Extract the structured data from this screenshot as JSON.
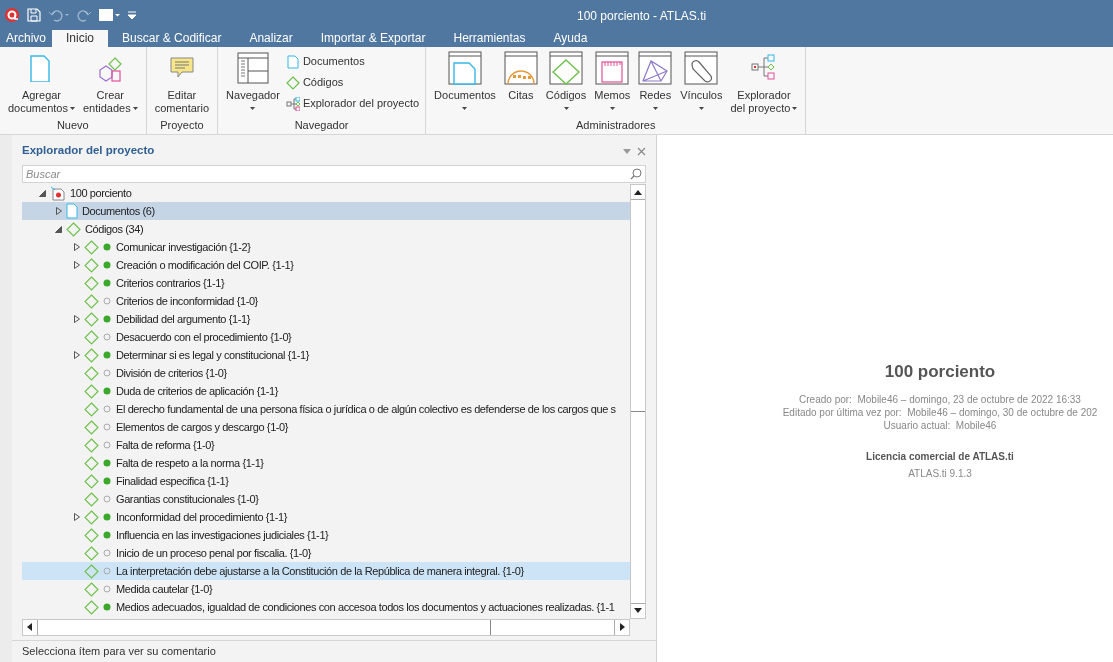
{
  "window": {
    "title": "100 porciento - ATLAS.ti"
  },
  "menu_tabs": [
    {
      "label": "Archivo",
      "selected": false
    },
    {
      "label": "Inicio",
      "selected": true
    },
    {
      "label": "Buscar & Codificar",
      "selected": false
    },
    {
      "label": "Analizar",
      "selected": false
    },
    {
      "label": "Importar & Exportar",
      "selected": false
    },
    {
      "label": "Herramientas",
      "selected": false
    },
    {
      "label": "Ayuda",
      "selected": false
    }
  ],
  "ribbon": [
    {
      "label": "Nuevo",
      "buttons": [
        {
          "kind": "large",
          "lines": [
            "Agregar",
            "documentos"
          ],
          "has_menu": true
        },
        {
          "kind": "large",
          "lines": [
            "Crear",
            "entidades"
          ],
          "has_menu": true
        }
      ]
    },
    {
      "label": "Proyecto",
      "buttons": [
        {
          "kind": "large",
          "lines": [
            "Editar",
            "comentario"
          ],
          "has_menu": false
        }
      ]
    },
    {
      "label": "Navegador",
      "buttons": [
        {
          "kind": "large",
          "lines": [
            "Navegador"
          ],
          "has_menu": true
        },
        {
          "kind": "small",
          "lines": [
            "Documentos"
          ]
        },
        {
          "kind": "small",
          "lines": [
            "Códigos"
          ]
        },
        {
          "kind": "small",
          "lines": [
            "Explorador del proyecto"
          ]
        }
      ]
    },
    {
      "label": "Administradores",
      "buttons": [
        {
          "kind": "large",
          "lines": [
            "Documentos"
          ],
          "has_menu": true
        },
        {
          "kind": "large",
          "lines": [
            "Citas"
          ],
          "has_menu": false
        },
        {
          "kind": "large",
          "lines": [
            "Códigos"
          ],
          "has_menu": true
        },
        {
          "kind": "large",
          "lines": [
            "Memos"
          ],
          "has_menu": true
        },
        {
          "kind": "large",
          "lines": [
            "Redes"
          ],
          "has_menu": true
        },
        {
          "kind": "large",
          "lines": [
            "Vínculos"
          ],
          "has_menu": true
        },
        {
          "kind": "large",
          "lines": [
            "Explorador",
            "del proyecto"
          ],
          "has_menu": true
        }
      ]
    }
  ],
  "explorer": {
    "title": "Explorador del proyecto",
    "search": {
      "placeholder": "Buscar"
    },
    "tree": [
      {
        "kind": "project",
        "label": "100 porciento",
        "expandable": true,
        "expanded": true,
        "selected": false,
        "hovered": false,
        "children": [
          {
            "kind": "documents",
            "label": "Documentos (6)",
            "expandable": true,
            "expanded": false,
            "selected": true,
            "hovered": false
          },
          {
            "kind": "codes",
            "label": "Códigos (34)",
            "expandable": true,
            "expanded": true,
            "selected": false,
            "hovered": false,
            "children": [
              {
                "kind": "code",
                "label": "Comunicar investigación {1-2}",
                "expandable": true,
                "expanded": false,
                "filled": true,
                "selected": false,
                "hovered": false
              },
              {
                "kind": "code",
                "label": "Creación o modificación del COIP. {1-1}",
                "expandable": true,
                "expanded": false,
                "filled": true,
                "selected": false,
                "hovered": false
              },
              {
                "kind": "code",
                "label": "Criterios contrarios {1-1}",
                "expandable": false,
                "filled": true,
                "selected": false,
                "hovered": false
              },
              {
                "kind": "code",
                "label": "Criterios de inconformidad {1-0}",
                "expandable": false,
                "filled": false,
                "selected": false,
                "hovered": false
              },
              {
                "kind": "code",
                "label": "Debilidad del argumento {1-1}",
                "expandable": true,
                "expanded": false,
                "filled": true,
                "selected": false,
                "hovered": false
              },
              {
                "kind": "code",
                "label": "Desacuerdo con el procedimiento {1-0}",
                "expandable": false,
                "filled": false,
                "selected": false,
                "hovered": false
              },
              {
                "kind": "code",
                "label": "Determinar si es legal y constitucional {1-1}",
                "expandable": true,
                "expanded": false,
                "filled": true,
                "selected": false,
                "hovered": false
              },
              {
                "kind": "code",
                "label": "División de criterios {1-0}",
                "expandable": false,
                "filled": false,
                "selected": false,
                "hovered": false
              },
              {
                "kind": "code",
                "label": "Duda de criterios de aplicación {1-1}",
                "expandable": false,
                "filled": true,
                "selected": false,
                "hovered": false
              },
              {
                "kind": "code",
                "label": "El derecho fundamental de una persona física o jurídica o de algún colectivo es defenderse de los cargos que s",
                "expandable": false,
                "filled": false,
                "selected": false,
                "hovered": false
              },
              {
                "kind": "code",
                "label": "Elementos de cargos y descargo {1-0}",
                "expandable": false,
                "filled": false,
                "selected": false,
                "hovered": false
              },
              {
                "kind": "code",
                "label": "Falta de reforma {1-0}",
                "expandable": false,
                "filled": false,
                "selected": false,
                "hovered": false
              },
              {
                "kind": "code",
                "label": "Falta de respeto a la norma {1-1}",
                "expandable": false,
                "filled": true,
                "selected": false,
                "hovered": false
              },
              {
                "kind": "code",
                "label": "Finalidad especifica {1-1}",
                "expandable": false,
                "filled": true,
                "selected": false,
                "hovered": false
              },
              {
                "kind": "code",
                "label": "Garantias constitucionales {1-0}",
                "expandable": false,
                "filled": false,
                "selected": false,
                "hovered": false
              },
              {
                "kind": "code",
                "label": "Inconformidad del procedimiento {1-1}",
                "expandable": true,
                "expanded": false,
                "filled": true,
                "selected": false,
                "hovered": false
              },
              {
                "kind": "code",
                "label": "Influencia en las investigaciones judiciales {1-1}",
                "expandable": false,
                "filled": true,
                "selected": false,
                "hovered": false
              },
              {
                "kind": "code",
                "label": "Inicio de un proceso penal por fiscalia. {1-0}",
                "expandable": false,
                "filled": false,
                "selected": false,
                "hovered": false
              },
              {
                "kind": "code",
                "label": "La interpretación debe ajustarse a la Constitución de la República de manera integral. {1-0}",
                "expandable": false,
                "filled": false,
                "selected": false,
                "hovered": true
              },
              {
                "kind": "code",
                "label": "Medida cautelar {1-0}",
                "expandable": false,
                "filled": false,
                "selected": false,
                "hovered": false
              },
              {
                "kind": "code",
                "label": "Medios adecuados, igualdad de condiciones con accesoa todos los documentos y actuaciones realizadas. {1-1",
                "expandable": false,
                "filled": true,
                "selected": false,
                "hovered": false
              }
            ]
          }
        ]
      }
    ],
    "status_text": "Selecciona ítem para ver su comentario"
  },
  "details": {
    "title": "100 porciento",
    "created": "Creado por:  Mobile46 – domingo, 23 de octubre de 2022 16:33",
    "edited": "Editado por última vez por:  Mobile46 – domingo, 30 de octubre de 202",
    "current_user": "Usuario actual:  Mobile46",
    "license": "Licencia comercial de ATLAS.ti",
    "version": "ATLAS.ti 9.1.3"
  }
}
